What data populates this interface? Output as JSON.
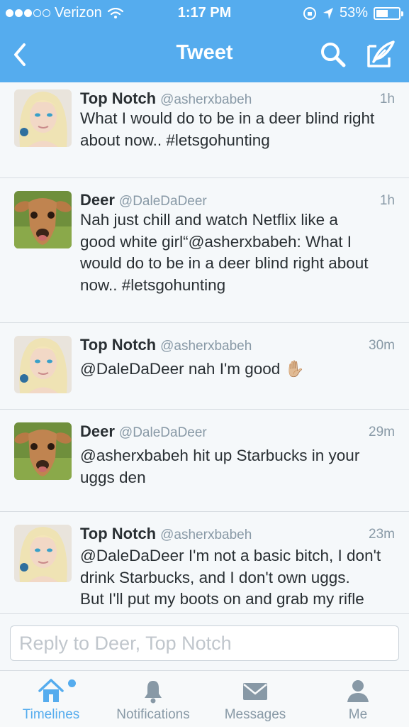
{
  "status_bar": {
    "carrier": "Verizon",
    "time": "1:17 PM",
    "battery": "53%",
    "battery_level": 0.53
  },
  "nav": {
    "title": "Tweet",
    "back_icon": "chevron-left-icon",
    "search_icon": "search-icon",
    "compose_icon": "compose-icon"
  },
  "tweets": [
    {
      "name": "Top Notch",
      "handle": "@asherxbabeh",
      "time": "1h",
      "text": "What I would do to be in a deer blind right\nabout now.. #letsgohunting",
      "avatar": "woman-avatar"
    },
    {
      "name": "Deer",
      "handle": "@DaleDaDeer",
      "time": "1h",
      "text": "Nah just chill and watch Netflix like a\ngood white girl“@asherxbabeh: What I\nwould do to be in a deer blind right about\nnow.. #letsgohunting",
      "avatar": "deer-avatar"
    },
    {
      "name": "Top Notch",
      "handle": "@asherxbabeh",
      "time": "30m",
      "text": "@DaleDaDeer nah I'm good ✋🏼",
      "avatar": "woman-avatar"
    },
    {
      "name": "Deer",
      "handle": "@DaleDaDeer",
      "time": "29m",
      "text": "@asherxbabeh hit up Starbucks in your\nuggs den",
      "avatar": "deer-avatar"
    },
    {
      "name": "Top Notch",
      "handle": "@asherxbabeh",
      "time": "23m",
      "text": "@DaleDaDeer I'm not a basic bitch, I don't\ndrink Starbucks, and I don't own uggs.\nBut I'll put my boots on and grab my rifle",
      "avatar": "woman-avatar"
    }
  ],
  "reply": {
    "placeholder": "Reply to Deer, Top Notch"
  },
  "tabs": [
    {
      "label": "Timelines",
      "icon": "home-icon",
      "active": true
    },
    {
      "label": "Notifications",
      "icon": "bell-icon",
      "active": false
    },
    {
      "label": "Messages",
      "icon": "envelope-icon",
      "active": false
    },
    {
      "label": "Me",
      "icon": "person-icon",
      "active": false
    }
  ],
  "colors": {
    "brand": "#55acee",
    "text": "#292f33",
    "muted": "#8899a6",
    "background": "#f5f8fa"
  }
}
